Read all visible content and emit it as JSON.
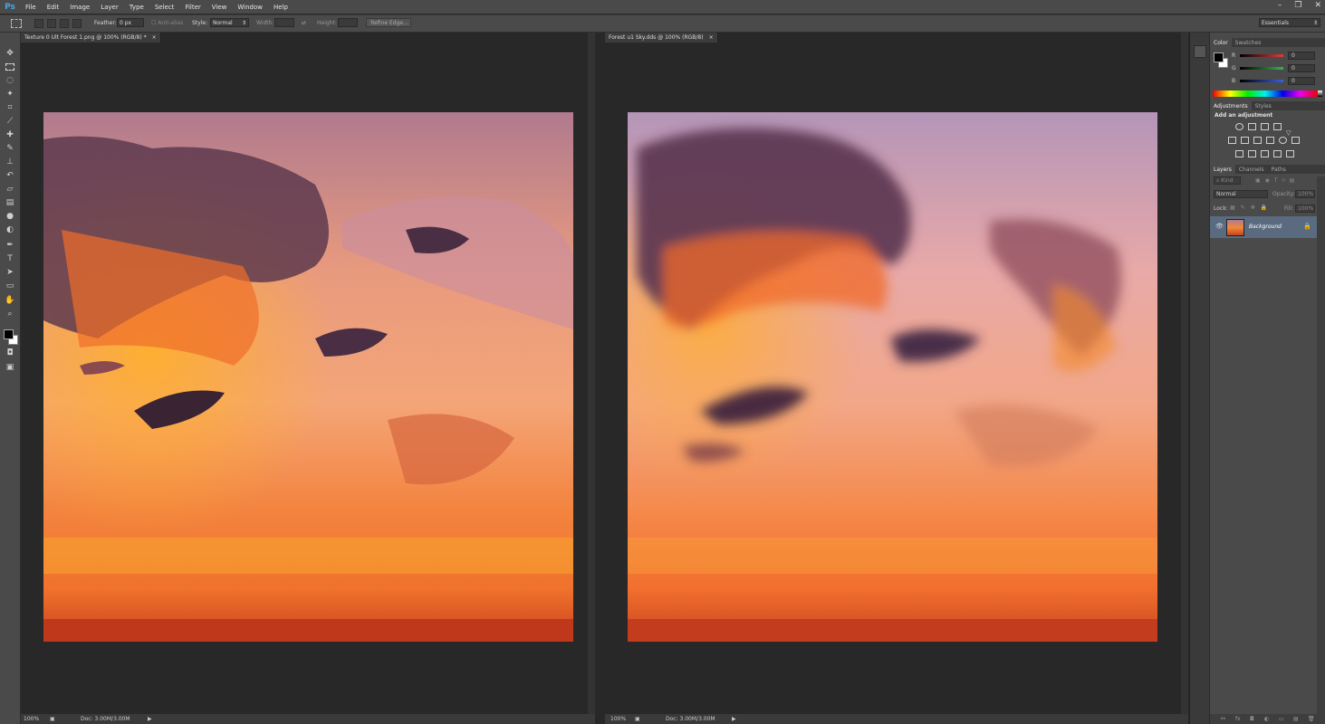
{
  "app": {
    "logo": "Ps"
  },
  "menu": [
    "File",
    "Edit",
    "Image",
    "Layer",
    "Type",
    "Select",
    "Filter",
    "View",
    "Window",
    "Help"
  ],
  "window_controls": [
    "–",
    "❐",
    "✕"
  ],
  "options": {
    "feather_label": "Feather:",
    "feather_value": "0 px",
    "antialias_label": "Anti-alias",
    "style_label": "Style:",
    "style_value": "Normal",
    "width_label": "Width:",
    "height_label": "Height:",
    "refine_edge": "Refine Edge...",
    "workspace": "Essentials"
  },
  "documents": [
    {
      "tab": "Texture 0 Ult Forest 1.png @ 100% (RGB/8) *",
      "close": "×",
      "zoom": "100%",
      "doc_info": "Doc: 3.00M/3.00M"
    },
    {
      "tab": "Forest u1 Sky.dds @ 100% (RGB/8)",
      "close": "×",
      "zoom": "100%",
      "doc_info": "Doc: 3.00M/3.00M"
    }
  ],
  "color_panel": {
    "tabs": [
      "Color",
      "Swatches"
    ],
    "channels": [
      {
        "label": "R",
        "value": "0",
        "color": "#e23b3b"
      },
      {
        "label": "G",
        "value": "0",
        "color": "#36b44a"
      },
      {
        "label": "B",
        "value": "0",
        "color": "#3a5fe0"
      }
    ]
  },
  "adjustments_panel": {
    "tabs": [
      "Adjustments",
      "Styles"
    ],
    "heading": "Add an adjustment"
  },
  "layers_panel": {
    "tabs": [
      "Layers",
      "Channels",
      "Paths"
    ],
    "kind": "Kind",
    "blend": "Normal",
    "opacity_label": "Opacity:",
    "opacity_value": "100%",
    "lock_label": "Lock:",
    "fill_label": "Fill:",
    "fill_value": "100%",
    "layers": [
      {
        "name": "Background",
        "visible": true,
        "locked": true
      }
    ]
  },
  "colors": {
    "accent": "#4fa3e0",
    "layer_selected": "#5a6b80"
  }
}
